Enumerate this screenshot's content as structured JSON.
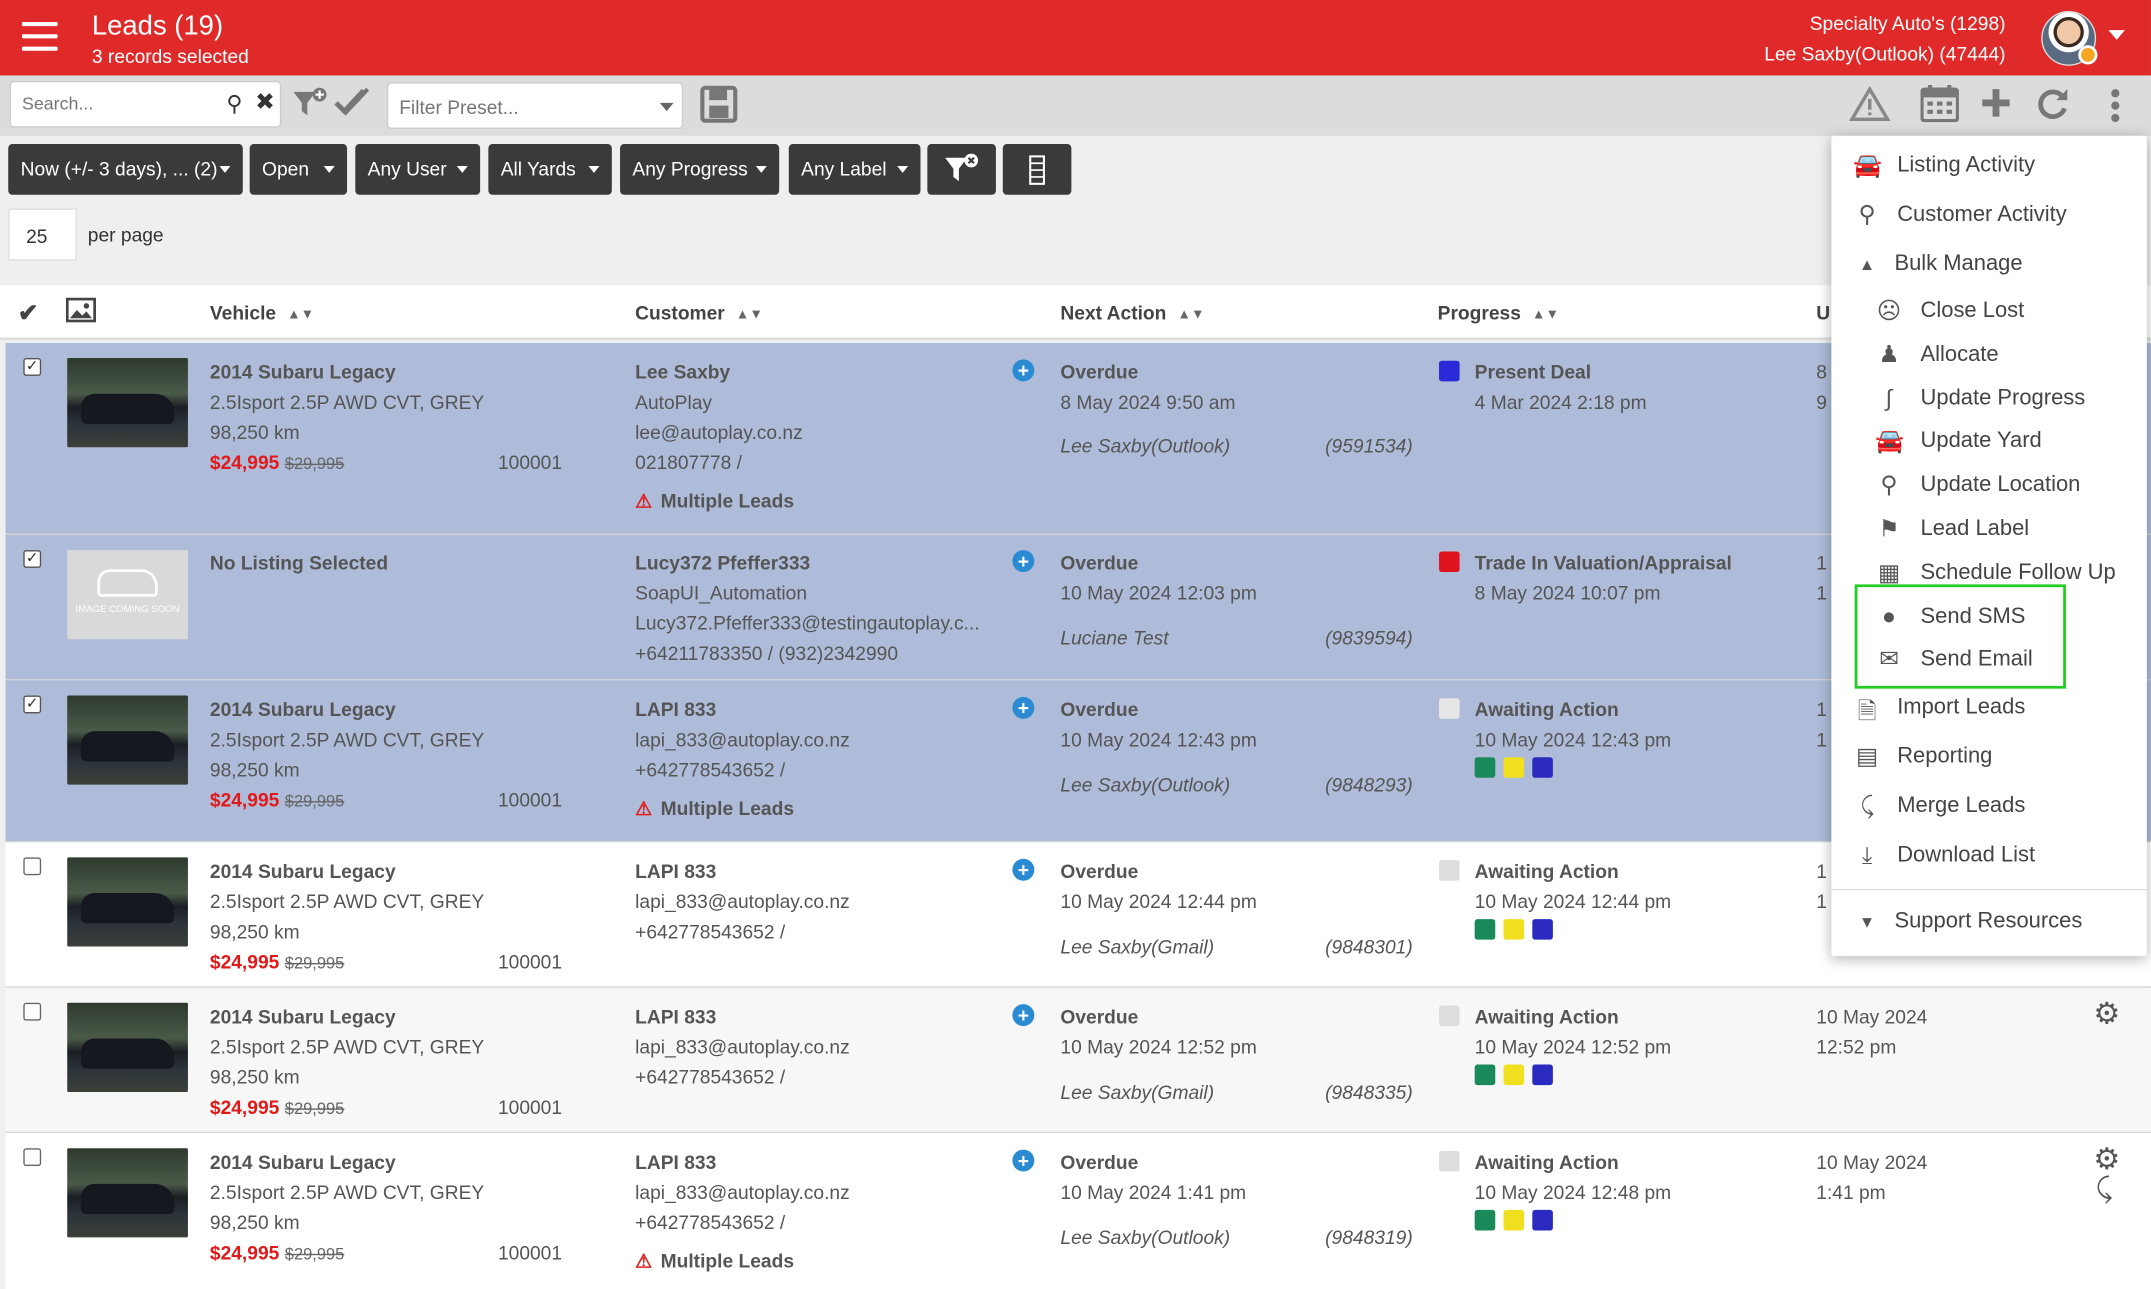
{
  "header": {
    "title": "Leads (19)",
    "subtitle": "3 records selected",
    "account_line1": "Specialty Auto's (1298)",
    "account_line2": "Lee Saxby(Outlook) (47444)"
  },
  "toolbar": {
    "search_placeholder": "Search...",
    "preset_placeholder": "Filter Preset..."
  },
  "filters": [
    "Now (+/- 3 days), ... (2)",
    "Open",
    "Any User",
    "All Yards",
    "Any Progress",
    "Any Label"
  ],
  "per_page": {
    "value": "25",
    "label": "per page"
  },
  "columns": {
    "vehicle": "Vehicle",
    "customer": "Customer",
    "next_action": "Next Action",
    "progress": "Progress",
    "updated": "U"
  },
  "rows": [
    {
      "vehicle": "2014 Subaru Legacy",
      "spec": "2.5Isport 2.5P AWD CVT, GREY",
      "km": "98,250 km",
      "price": "$24,995",
      "old_price": "$29,995",
      "stock": "100001",
      "customer": "Lee Saxby",
      "c2": "AutoPlay",
      "c3": "lee@autoplay.co.nz",
      "c4": "021807778 /",
      "warning": "Multiple Leads",
      "action": "Overdue",
      "action_date": "8 May 2024 9:50 am",
      "user": "Lee Saxby(Outlook)",
      "ref": "(9591534)",
      "progress": "Present Deal",
      "progress_date": "4 Mar 2024 2:18 pm",
      "updated1": "8",
      "updated2": "9"
    },
    {
      "vehicle": "No Listing Selected",
      "image_placeholder": "IMAGE COMING SOON",
      "customer": "Lucy372 Pfeffer333",
      "c2": "SoapUI_Automation",
      "c3": "Lucy372.Pfeffer333@testingautoplay.c...",
      "c4": "+64211783350 / (932)2342990",
      "action": "Overdue",
      "action_date": "10 May 2024 12:03 pm",
      "user": "Luciane Test",
      "ref": "(9839594)",
      "progress": "Trade In Valuation/Appraisal",
      "progress_date": "8 May 2024 10:07 pm",
      "updated1": "1",
      "updated2": "1"
    },
    {
      "vehicle": "2014 Subaru Legacy",
      "spec": "2.5Isport 2.5P AWD CVT, GREY",
      "km": "98,250 km",
      "price": "$24,995",
      "old_price": "$29,995",
      "stock": "100001",
      "customer": "LAPI 833",
      "c2": "lapi_833@autoplay.co.nz",
      "c3": "+642778543652 /",
      "warning": "Multiple Leads",
      "action": "Overdue",
      "action_date": "10 May 2024 12:43 pm",
      "user": "Lee Saxby(Outlook)",
      "ref": "(9848293)",
      "progress": "Awaiting Action",
      "progress_date": "10 May 2024 12:43 pm",
      "updated1": "1",
      "updated2": "1"
    },
    {
      "vehicle": "2014 Subaru Legacy",
      "spec": "2.5Isport 2.5P AWD CVT, GREY",
      "km": "98,250 km",
      "price": "$24,995",
      "old_price": "$29,995",
      "stock": "100001",
      "customer": "LAPI 833",
      "c2": "lapi_833@autoplay.co.nz",
      "c3": "+642778543652 /",
      "action": "Overdue",
      "action_date": "10 May 2024 12:44 pm",
      "user": "Lee Saxby(Gmail)",
      "ref": "(9848301)",
      "progress": "Awaiting Action",
      "progress_date": "10 May 2024 12:44 pm",
      "updated1": "1",
      "updated2": "1"
    },
    {
      "vehicle": "2014 Subaru Legacy",
      "spec": "2.5Isport 2.5P AWD CVT, GREY",
      "km": "98,250 km",
      "price": "$24,995",
      "old_price": "$29,995",
      "stock": "100001",
      "customer": "LAPI 833",
      "c2": "lapi_833@autoplay.co.nz",
      "c3": "+642778543652 /",
      "action": "Overdue",
      "action_date": "10 May 2024 12:52 pm",
      "user": "Lee Saxby(Gmail)",
      "ref": "(9848335)",
      "progress": "Awaiting Action",
      "progress_date": "10 May 2024 12:52 pm",
      "updated1": "10 May 2024",
      "updated2": "12:52 pm"
    },
    {
      "vehicle": "2014 Subaru Legacy",
      "spec": "2.5Isport 2.5P AWD CVT, GREY",
      "km": "98,250 km",
      "price": "$24,995",
      "old_price": "$29,995",
      "stock": "100001",
      "customer": "LAPI 833",
      "c2": "lapi_833@autoplay.co.nz",
      "c3": "+642778543652 /",
      "warning": "Multiple Leads",
      "action": "Overdue",
      "action_date": "10 May 2024 1:41 pm",
      "user": "Lee Saxby(Outlook)",
      "ref": "(9848319)",
      "progress": "Awaiting Action",
      "progress_date": "10 May 2024 12:48 pm",
      "updated1": "10 May 2024",
      "updated2": "1:41 pm"
    }
  ],
  "menu": {
    "listing_activity": "Listing Activity",
    "customer_activity": "Customer Activity",
    "bulk_manage": "Bulk Manage",
    "close_lost": "Close Lost",
    "allocate": "Allocate",
    "update_progress": "Update Progress",
    "update_yard": "Update Yard",
    "update_location": "Update Location",
    "lead_label": "Lead Label",
    "schedule_follow_up": "Schedule Follow Up",
    "send_sms": "Send SMS",
    "send_email": "Send Email",
    "import_leads": "Import Leads",
    "reporting": "Reporting",
    "merge_leads": "Merge Leads",
    "download_list": "Download List",
    "support_resources": "Support Resources"
  },
  "colors": {
    "header": "#e02a2a",
    "selected_row": "#aebcd9",
    "present_deal": "#2a2ad8",
    "trade_in": "#e0141e",
    "awaiting": "#dddddd",
    "label_green": "#1a8a5a",
    "label_yellow": "#f0e020",
    "label_blue": "#2a2ac0",
    "highlight": "#22cc22"
  }
}
